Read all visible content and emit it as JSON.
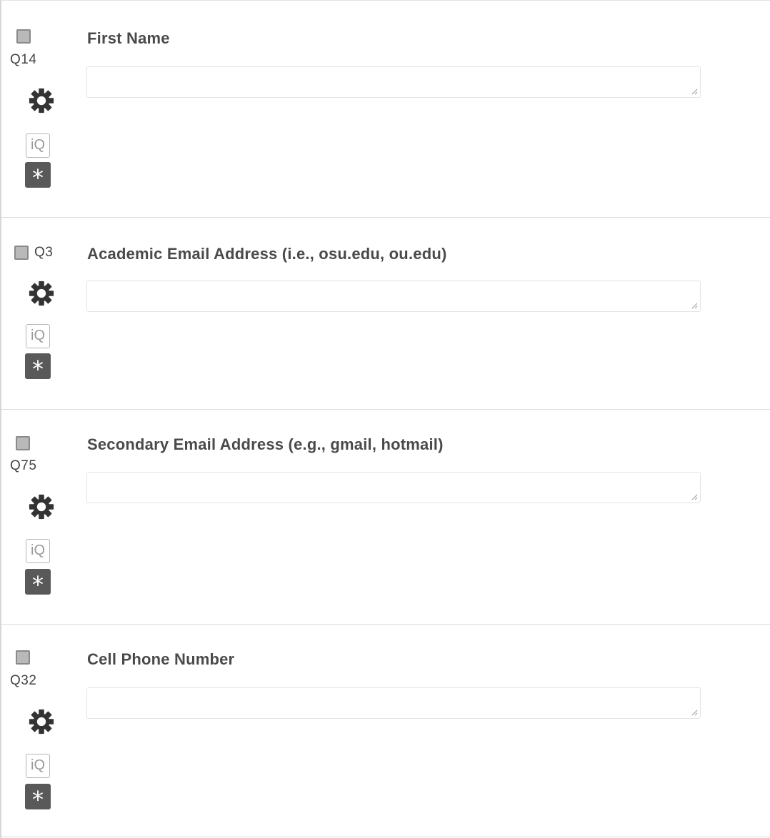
{
  "questions": [
    {
      "id": "Q14",
      "text": "First Name",
      "answer": ""
    },
    {
      "id": "Q3",
      "text": "Academic Email Address (i.e., osu.edu, ou.edu)",
      "answer": ""
    },
    {
      "id": "Q75",
      "text": "Secondary Email Address (e.g., gmail, hotmail)",
      "answer": ""
    },
    {
      "id": "Q32",
      "text": "Cell Phone Number",
      "answer": ""
    }
  ],
  "icons": {
    "select": "checkbox-icon",
    "settings": "gear-icon",
    "iq": "iq-score-icon",
    "required": "asterisk-icon"
  },
  "labels": {
    "iq": "iQ",
    "required": "*"
  },
  "colors": {
    "gear": "#333333",
    "required_bg": "#595959",
    "border": "#dcdcdc"
  }
}
